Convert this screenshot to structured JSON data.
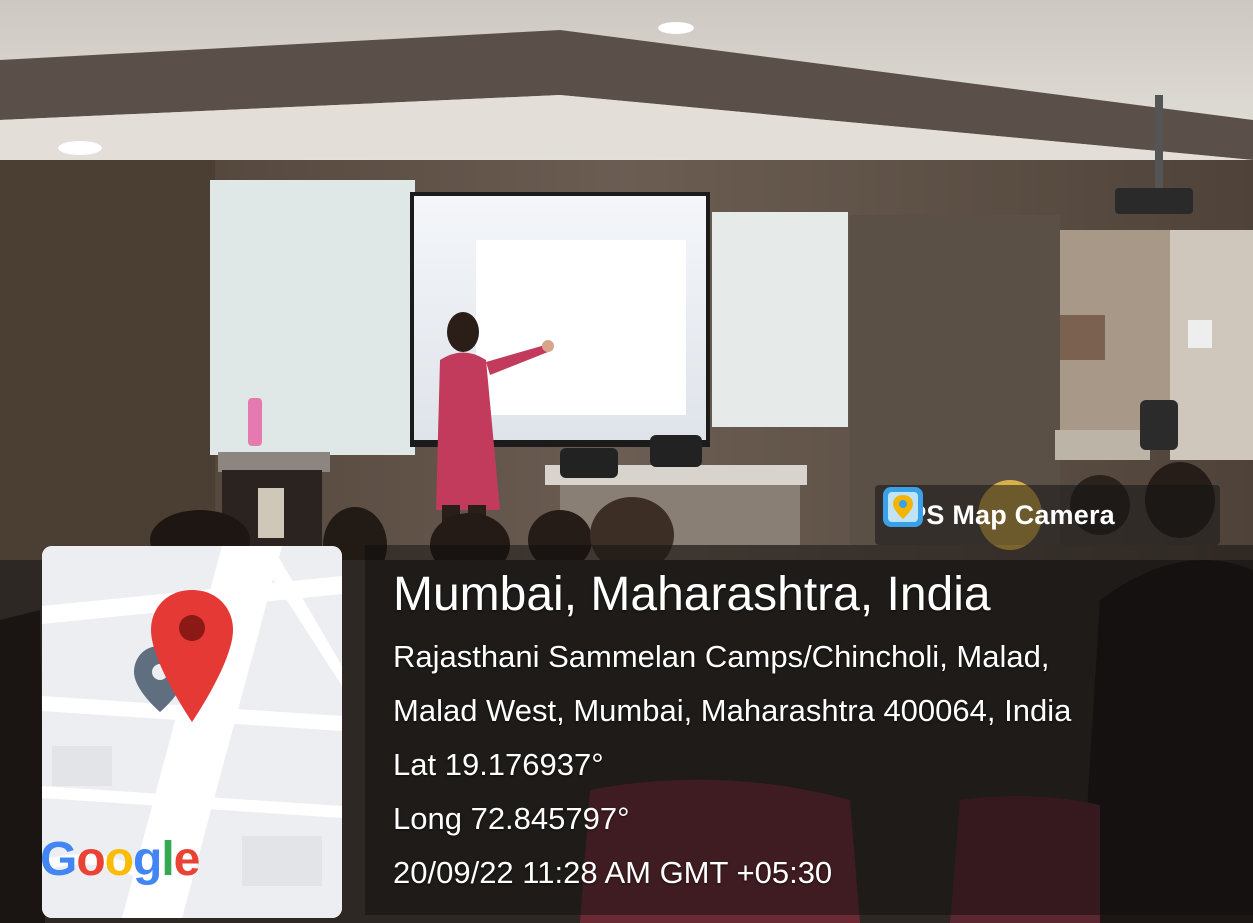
{
  "badge": {
    "app_name": "GPS Map Camera",
    "icon": "gps-map-camera-app-icon"
  },
  "location": {
    "city": "Mumbai, Maharashtra, India",
    "address_line1": "Rajasthani Sammelan Camps/Chincholi, Malad,",
    "address_line2": "Malad West, Mumbai, Maharashtra 400064, India",
    "lat": "Lat 19.176937°",
    "long": "Long 72.845797°",
    "datetime": "20/09/22 11:28 AM GMT +05:30"
  },
  "map": {
    "provider": "Google",
    "pin_icon": "location-pin-icon",
    "colors": {
      "pin": "#e53935",
      "google_blue": "#4285f4",
      "google_red": "#ea4335",
      "google_yellow": "#fbbc05",
      "google_green": "#34a853"
    }
  }
}
